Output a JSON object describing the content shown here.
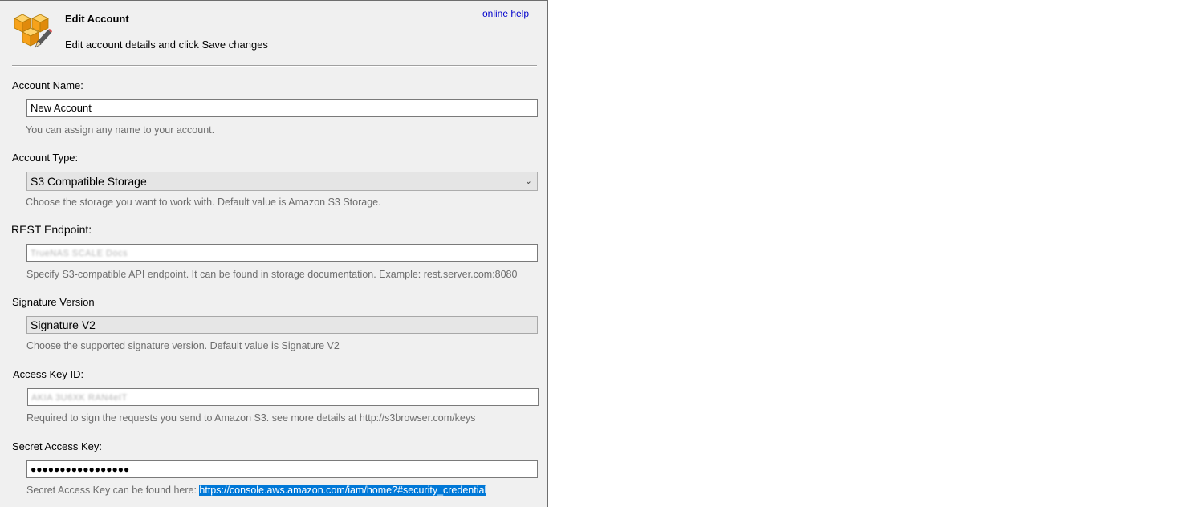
{
  "header": {
    "title": "Edit Account",
    "subtitle": "Edit account details and click Save changes",
    "help_link": "online help"
  },
  "fields": {
    "account_name": {
      "label": "Account Name:",
      "value": "New Account",
      "hint": "You can assign any name to your account."
    },
    "account_type": {
      "label": "Account Type:",
      "value": "S3 Compatible Storage",
      "hint": "Choose the storage you want to work with. Default value is Amazon S3 Storage."
    },
    "rest_endpoint": {
      "label": "REST Endpoint:",
      "value": "TrueNAS SCALE Docs",
      "hint": "Specify S3-compatible API endpoint. It can be found in storage documentation. Example: rest.server.com:8080"
    },
    "signature_version": {
      "label": "Signature Version",
      "value": "Signature V2",
      "hint": "Choose the supported signature version. Default value is Signature V2"
    },
    "access_key_id": {
      "label": "Access Key ID:",
      "value": "AKIA 3U6XK RAN4eIT",
      "hint": "Required to sign the requests you send to Amazon S3. see more details at http://s3browser.com/keys"
    },
    "secret_access_key": {
      "label": "Secret Access Key:",
      "value": "●●●●●●●●●●●●●●●●●",
      "hint_prefix": "Secret Access Key can be found here: ",
      "hint_link": "https://console.aws.amazon.com/iam/home?#security_credential"
    }
  },
  "colors": {
    "panel_bg": "#f0f0f0",
    "link": "#0000cc",
    "selection": "#0078d7",
    "hint_text": "#6d6d6d"
  }
}
